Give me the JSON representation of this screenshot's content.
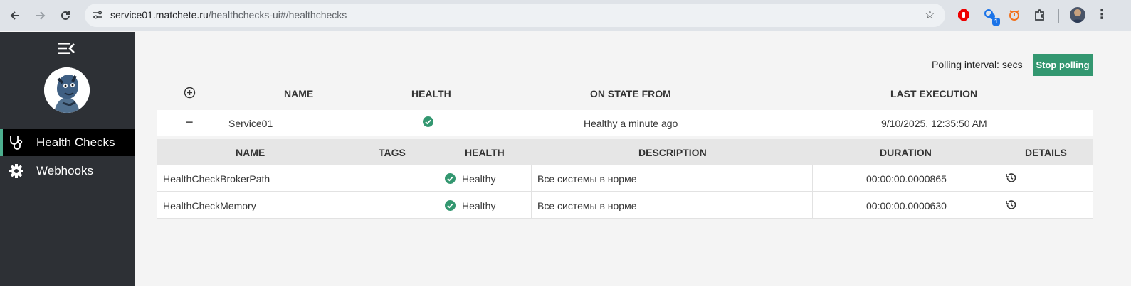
{
  "browser": {
    "url_host": "service01.matchete.ru",
    "url_path": "/healthchecks-ui#/healthchecks",
    "extension_badge": "1"
  },
  "sidebar": {
    "items": [
      {
        "label": "Health Checks",
        "icon": "stethoscope-icon",
        "active": true
      },
      {
        "label": "Webhooks",
        "icon": "gear-icon",
        "active": false
      }
    ]
  },
  "polling": {
    "label": "Polling interval: secs",
    "button": "Stop polling"
  },
  "table": {
    "headers": [
      "NAME",
      "HEALTH",
      "ON STATE FROM",
      "LAST EXECUTION"
    ],
    "service": {
      "name": "Service01",
      "on_state_from": "Healthy a minute ago",
      "last_execution": "9/10/2025, 12:35:50 AM"
    }
  },
  "details": {
    "headers": [
      "NAME",
      "TAGS",
      "HEALTH",
      "DESCRIPTION",
      "DURATION",
      "DETAILS"
    ],
    "rows": [
      {
        "name": "HealthCheckBrokerPath",
        "tags": "",
        "health": "Healthy",
        "description": "Все системы в норме",
        "duration": "00:00:00.0000865"
      },
      {
        "name": "HealthCheckMemory",
        "tags": "",
        "health": "Healthy",
        "description": "Все системы в норме",
        "duration": "00:00:00.0000630"
      }
    ]
  },
  "colors": {
    "sidebar_bg": "#2d3035",
    "accent": "#339770",
    "healthy": "#339770"
  }
}
